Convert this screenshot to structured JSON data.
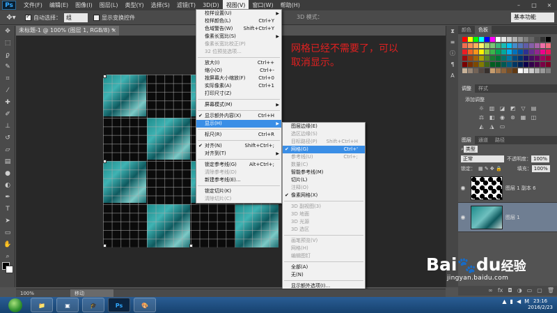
{
  "app": {
    "logo": "Ps"
  },
  "menubar": {
    "items": [
      "文件(F)",
      "编辑(E)",
      "图像(I)",
      "图层(L)",
      "类型(Y)",
      "选择(S)",
      "滤镜(T)",
      "3D(D)",
      "视图(V)",
      "窗口(W)",
      "帮助(H)"
    ],
    "active": "视图(V)",
    "window_buttons": [
      "–",
      "□",
      "×"
    ]
  },
  "options_bar": {
    "auto_select_label": "自动选择：",
    "auto_select_value": "组",
    "show_transform_label": "显示变换控件",
    "mode_3d_label": "3D 模式：",
    "workspace": "基本功能"
  },
  "document": {
    "tab_title": "未标题-1 @ 100% (图层 1, RGB/8) *",
    "close": "×"
  },
  "annotation": "网格已经不需要了，可以取消显示。",
  "view_menu": [
    {
      "label": "校样设置(U)",
      "arrow": true
    },
    {
      "label": "校样颜色(L)",
      "shortcut": "Ctrl+Y"
    },
    {
      "label": "色域警告(W)",
      "shortcut": "Shift+Ctrl+Y"
    },
    {
      "label": "像素长宽比(S)",
      "arrow": true
    },
    {
      "label": "像素长宽比校正(P)",
      "disabled": true
    },
    {
      "label": "32 位预览选项...",
      "disabled": true
    },
    {
      "sep": true
    },
    {
      "label": "放大(I)",
      "shortcut": "Ctrl++"
    },
    {
      "label": "缩小(O)",
      "shortcut": "Ctrl+-"
    },
    {
      "label": "按屏幕大小缩放(F)",
      "shortcut": "Ctrl+0"
    },
    {
      "label": "实际像素(A)",
      "shortcut": "Ctrl+1"
    },
    {
      "label": "打印尺寸(Z)"
    },
    {
      "sep": true
    },
    {
      "label": "屏幕模式(M)",
      "arrow": true
    },
    {
      "sep": true
    },
    {
      "label": "显示额外内容(X)",
      "shortcut": "Ctrl+H",
      "checked": true
    },
    {
      "label": "显示(H)",
      "arrow": true,
      "highlight": true
    },
    {
      "sep": true
    },
    {
      "label": "标尺(R)",
      "shortcut": "Ctrl+R"
    },
    {
      "sep": true
    },
    {
      "label": "对齐(N)",
      "shortcut": "Shift+Ctrl+;",
      "checked": true
    },
    {
      "label": "对齐到(T)",
      "arrow": true
    },
    {
      "sep": true
    },
    {
      "label": "锁定参考线(G)",
      "shortcut": "Alt+Ctrl+;"
    },
    {
      "label": "清除参考线(D)",
      "disabled": true
    },
    {
      "label": "新建参考线(E)..."
    },
    {
      "sep": true
    },
    {
      "label": "锁定切片(K)"
    },
    {
      "label": "清除切片(C)",
      "disabled": true
    }
  ],
  "show_menu": [
    {
      "label": "图层边缘(E)"
    },
    {
      "label": "选区边缘(S)",
      "disabled": true
    },
    {
      "label": "目标路径(P)",
      "shortcut": "Shift+Ctrl+H",
      "disabled": true
    },
    {
      "label": "网格(G)",
      "shortcut": "Ctrl+'",
      "checked": true,
      "highlight": true
    },
    {
      "label": "参考线(U)",
      "shortcut": "Ctrl+;",
      "disabled": true
    },
    {
      "label": "数量(C)",
      "disabled": true
    },
    {
      "label": "智能参考线(M)"
    },
    {
      "label": "切片(L)"
    },
    {
      "label": "注释(O)",
      "disabled": true
    },
    {
      "label": "像素网格(X)",
      "checked": true
    },
    {
      "sep": true
    },
    {
      "label": "3D 副视图(3)",
      "disabled": true
    },
    {
      "label": "3D 地面",
      "disabled": true
    },
    {
      "label": "3D 光源",
      "disabled": true
    },
    {
      "label": "3D 选区",
      "disabled": true
    },
    {
      "sep": true
    },
    {
      "label": "画笔预览(V)",
      "disabled": true
    },
    {
      "label": "网格(H)",
      "disabled": true
    },
    {
      "label": "编辑图钉",
      "disabled": true
    },
    {
      "sep": true
    },
    {
      "label": "全部(A)"
    },
    {
      "label": "无(N)"
    },
    {
      "sep": true
    },
    {
      "label": "显示额外选项(I)..."
    }
  ],
  "panels": {
    "color_tabs": [
      "颜色",
      "色板"
    ],
    "adjust_tabs": [
      "调整",
      "样式"
    ],
    "adjust_title": "添加调整",
    "layers_tabs": [
      "图层",
      "通道",
      "路径"
    ],
    "kind_filter": "类型",
    "blend_mode": "正常",
    "opacity_label": "不透明度：",
    "opacity_value": "100%",
    "lock_label": "锁定：",
    "fill_label": "填充：",
    "fill_value": "100%",
    "layers": [
      {
        "name": "图层 1 副本 6",
        "selected": false
      },
      {
        "name": "图层 1",
        "selected": true
      }
    ],
    "footer_icons": [
      "link-icon",
      "fx-icon",
      "mask-icon",
      "adjust-icon",
      "folder-icon",
      "new-layer-icon",
      "trash-icon"
    ]
  },
  "status_bar": {
    "zoom": "100%",
    "mode": "移动"
  },
  "taskbar": {
    "apps": [
      "start-orb",
      "explorer",
      "media",
      "app",
      "photoshop",
      "paint"
    ],
    "clock_time": "23:16",
    "clock_date": "2016/2/23",
    "tray_m": "M"
  },
  "watermark": {
    "brand": "Bai",
    "brand2": "du",
    "suffix": "经验",
    "url": "jingyan.baidu.com"
  },
  "colors": {
    "menu_highlight": "#3a8ee6",
    "annotation": "#e02020",
    "ui_dark": "#535353"
  }
}
